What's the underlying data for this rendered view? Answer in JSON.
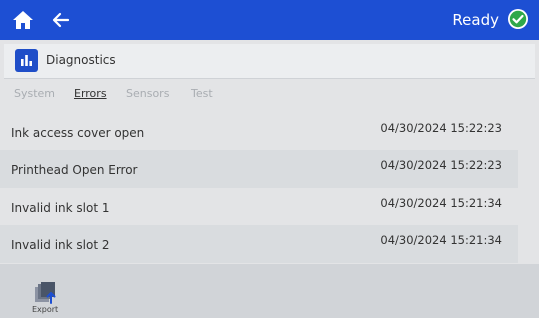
{
  "topbar": {
    "status_label": "Ready",
    "home_icon": "home-icon",
    "back_icon": "back-arrow-icon",
    "status_icon": "check-circle-icon",
    "accent_color": "#1d4fd3",
    "status_color": "#2fa84a"
  },
  "header": {
    "title": "Diagnostics",
    "icon": "bar-chart-icon"
  },
  "tabs": [
    {
      "label": "System",
      "active": false
    },
    {
      "label": "Errors",
      "active": true
    },
    {
      "label": "Sensors",
      "active": false
    },
    {
      "label": "Test",
      "active": false
    }
  ],
  "errors": [
    {
      "message": "Ink access cover open",
      "timestamp": "04/30/2024 15:22:23"
    },
    {
      "message": "Printhead Open Error",
      "timestamp": "04/30/2024 15:22:23"
    },
    {
      "message": "Invalid ink slot 1",
      "timestamp": "04/30/2024 15:21:34"
    },
    {
      "message": "Invalid ink slot 2",
      "timestamp": "04/30/2024 15:21:34"
    }
  ],
  "bottombar": {
    "export_label": "Export",
    "export_icon": "export-icon"
  }
}
